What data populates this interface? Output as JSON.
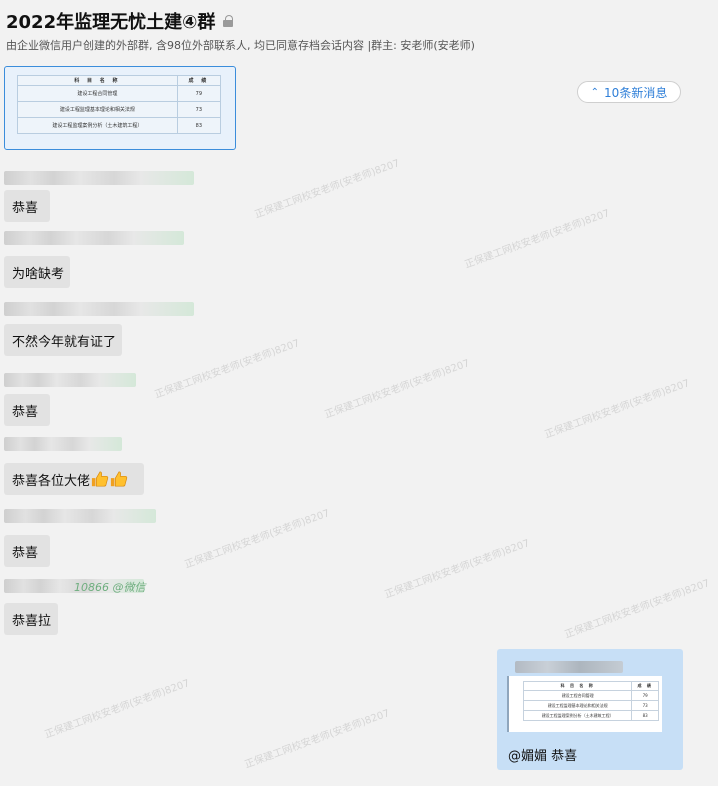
{
  "header": {
    "title": "2022年监理无忧土建④群",
    "subtitle": "由企业微信用户创建的外部群, 含98位外部联系人, 均已同意存档会话内容 |群主: 安老师(安老师)"
  },
  "new_messages_button": "10条新消息",
  "score_table": {
    "headers": [
      "科 目 名 称",
      "成 绩"
    ],
    "rows": [
      [
        "建设工程合同管理",
        "79"
      ],
      [
        "建设工程监理基本理论和相关法规",
        "73"
      ],
      [
        "建设工程监理案例分析（土木建筑工程）",
        "83"
      ]
    ]
  },
  "messages": [
    {
      "text": "恭喜"
    },
    {
      "text": "为啥缺考"
    },
    {
      "text": "不然今年就有证了"
    },
    {
      "text": "恭喜"
    },
    {
      "text": "恭喜各位大佬"
    },
    {
      "text": "恭喜"
    },
    {
      "text": "恭喜拉",
      "sender_visible": "10866 @微信"
    }
  ],
  "reply_card": {
    "mention": "@媚媚  恭喜",
    "table": {
      "headers": [
        "科 目 名 称",
        "成 绩"
      ],
      "rows": [
        [
          "建设工程合同管理",
          "79"
        ],
        [
          "建设工程监理基本理论和相关法规",
          "73"
        ],
        [
          "建设工程监理案例分析（土木建筑工程）",
          "83"
        ]
      ]
    }
  },
  "watermark": "正保建工网校安老师(安老师)8207",
  "colors": {
    "accent": "#2f7fd8",
    "bubble": "#e2e2e2",
    "self_bubble": "#c7dff6"
  }
}
